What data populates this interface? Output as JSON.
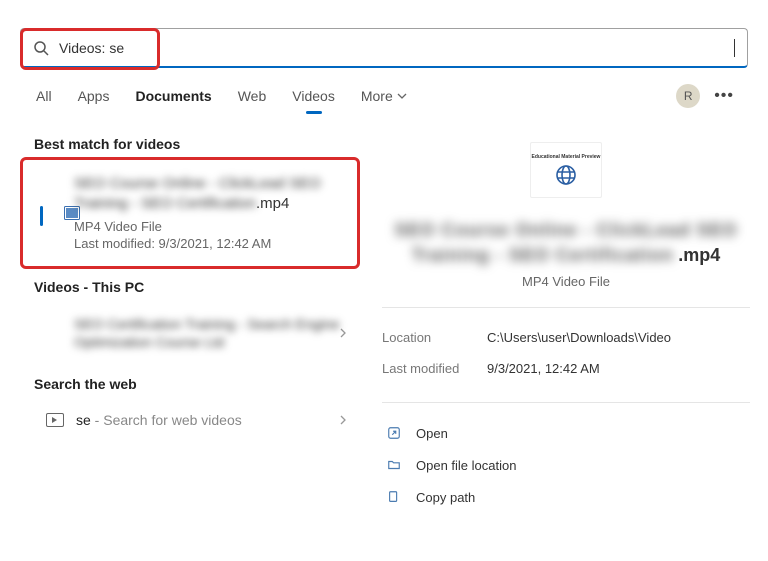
{
  "search": {
    "value": "Videos: se"
  },
  "tabs": {
    "items": [
      "All",
      "Apps",
      "Documents",
      "Web",
      "Videos",
      "More"
    ],
    "bold_index": 2,
    "active_index": 4,
    "avatar_initial": "R"
  },
  "left": {
    "best_match_heading": "Best match for videos",
    "result1": {
      "title_blur": "SEO Course Online - ClickLead SEO Training - SEO Certification",
      "title_suffix": ".mp4",
      "type": "MP4 Video File",
      "modified": "Last modified: 9/3/2021, 12:42 AM"
    },
    "videos_pc_heading": "Videos - This PC",
    "result2": {
      "title_blur": "SEO Certification Training - Search Engine Optimization Course Ltd"
    },
    "search_web_heading": "Search the web",
    "web": {
      "term": "se",
      "hint": " - Search for web videos"
    }
  },
  "right": {
    "thumb_text": "Educational Material Preview",
    "title_blur": "SEO Course Online - ClickLead SEO Training - SEO Certification",
    "title_suffix": ".mp4",
    "type": "MP4 Video File",
    "meta": {
      "location_label": "Location",
      "location_val": "C:\\Users\\user\\Downloads\\Video",
      "modified_label": "Last modified",
      "modified_val": "9/3/2021, 12:42 AM"
    },
    "actions": {
      "open": "Open",
      "open_loc": "Open file location",
      "copy": "Copy path"
    }
  }
}
